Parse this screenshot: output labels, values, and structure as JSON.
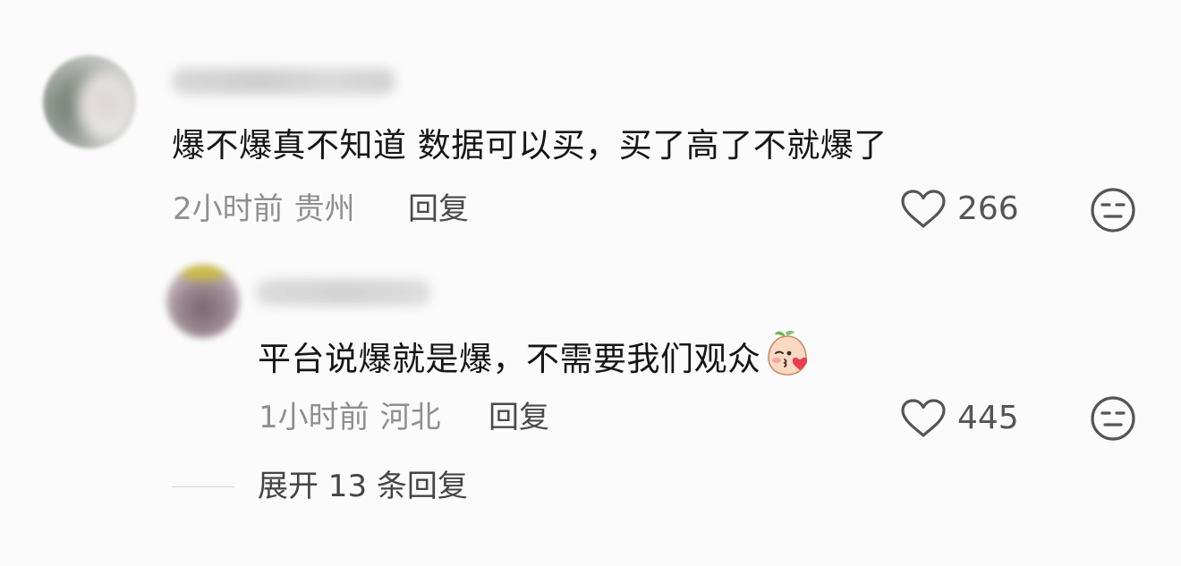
{
  "comments": [
    {
      "text": "爆不爆真不知道 数据可以买，买了高了不就爆了",
      "time": "2小时前",
      "location": "贵州",
      "reply_label": "回复",
      "likes": "266",
      "like_icon": "heart-outline-icon",
      "dislike_icon": "meh-face-icon"
    },
    {
      "text": "平台说爆就是爆，不需要我们观众",
      "emoji": "kiss-emoji",
      "time": "1小时前",
      "location": "河北",
      "reply_label": "回复",
      "likes": "445",
      "like_icon": "heart-outline-icon",
      "dislike_icon": "meh-face-icon"
    }
  ],
  "expand_replies": {
    "label": "展开 13 条回复"
  },
  "colors": {
    "background": "#fbfbfb",
    "text": "#161616",
    "meta": "#8f8f8f",
    "secondary": "#4a4a4a"
  }
}
